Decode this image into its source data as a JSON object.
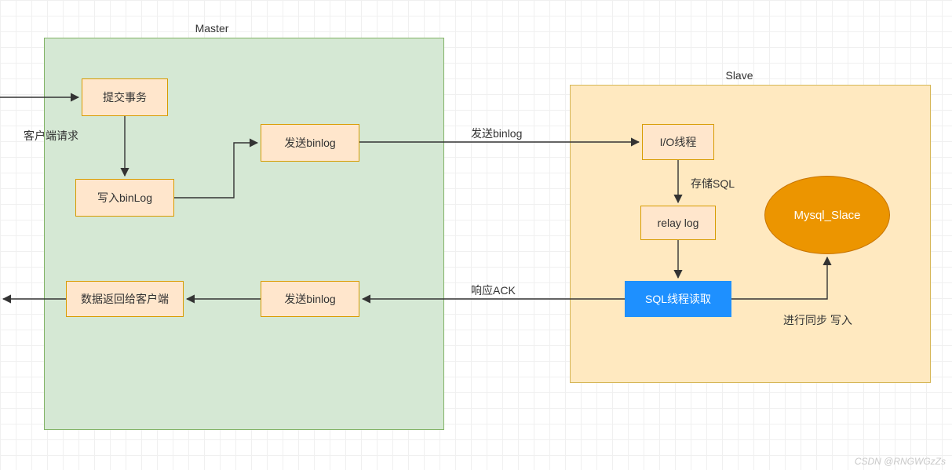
{
  "titles": {
    "master": "Master",
    "slave": "Slave"
  },
  "nodes": {
    "commit_tx": "提交事务",
    "write_binlog": "写入binLog",
    "send_binlog_top": "发送binlog",
    "return_client": "数据返回给客户端",
    "send_binlog_bottom": "发送binlog",
    "io_thread": "I/O线程",
    "relay_log": "relay log",
    "sql_thread": "SQL线程读取",
    "mysql_slave": "Mysql_Slace"
  },
  "labels": {
    "client_request": "客户端请求",
    "send_binlog_edge": "发送binlog",
    "store_sql": "存储SQL",
    "ack": "响应ACK",
    "sync_write": "进行同步 写入"
  },
  "watermark": "CSDN @RNGWGzZs"
}
